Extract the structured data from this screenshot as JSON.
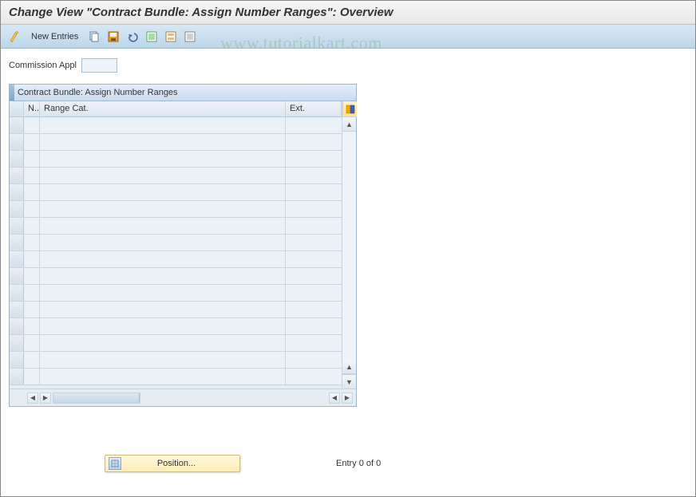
{
  "title": "Change View \"Contract Bundle: Assign Number Ranges\": Overview",
  "toolbar": {
    "new_entries_label": "New Entries"
  },
  "field": {
    "commission_appl_label": "Commission Appl",
    "commission_appl_value": ""
  },
  "table": {
    "title": "Contract Bundle: Assign Number Ranges",
    "columns": {
      "n": "N..",
      "range_cat": "Range Cat.",
      "ext": "Ext."
    },
    "rows": [
      {},
      {},
      {},
      {},
      {},
      {},
      {},
      {},
      {},
      {},
      {},
      {},
      {},
      {},
      {},
      {}
    ]
  },
  "footer": {
    "position_label": "Position...",
    "entry_text": "Entry 0 of 0"
  },
  "watermark": "www.tutorialkart.com"
}
